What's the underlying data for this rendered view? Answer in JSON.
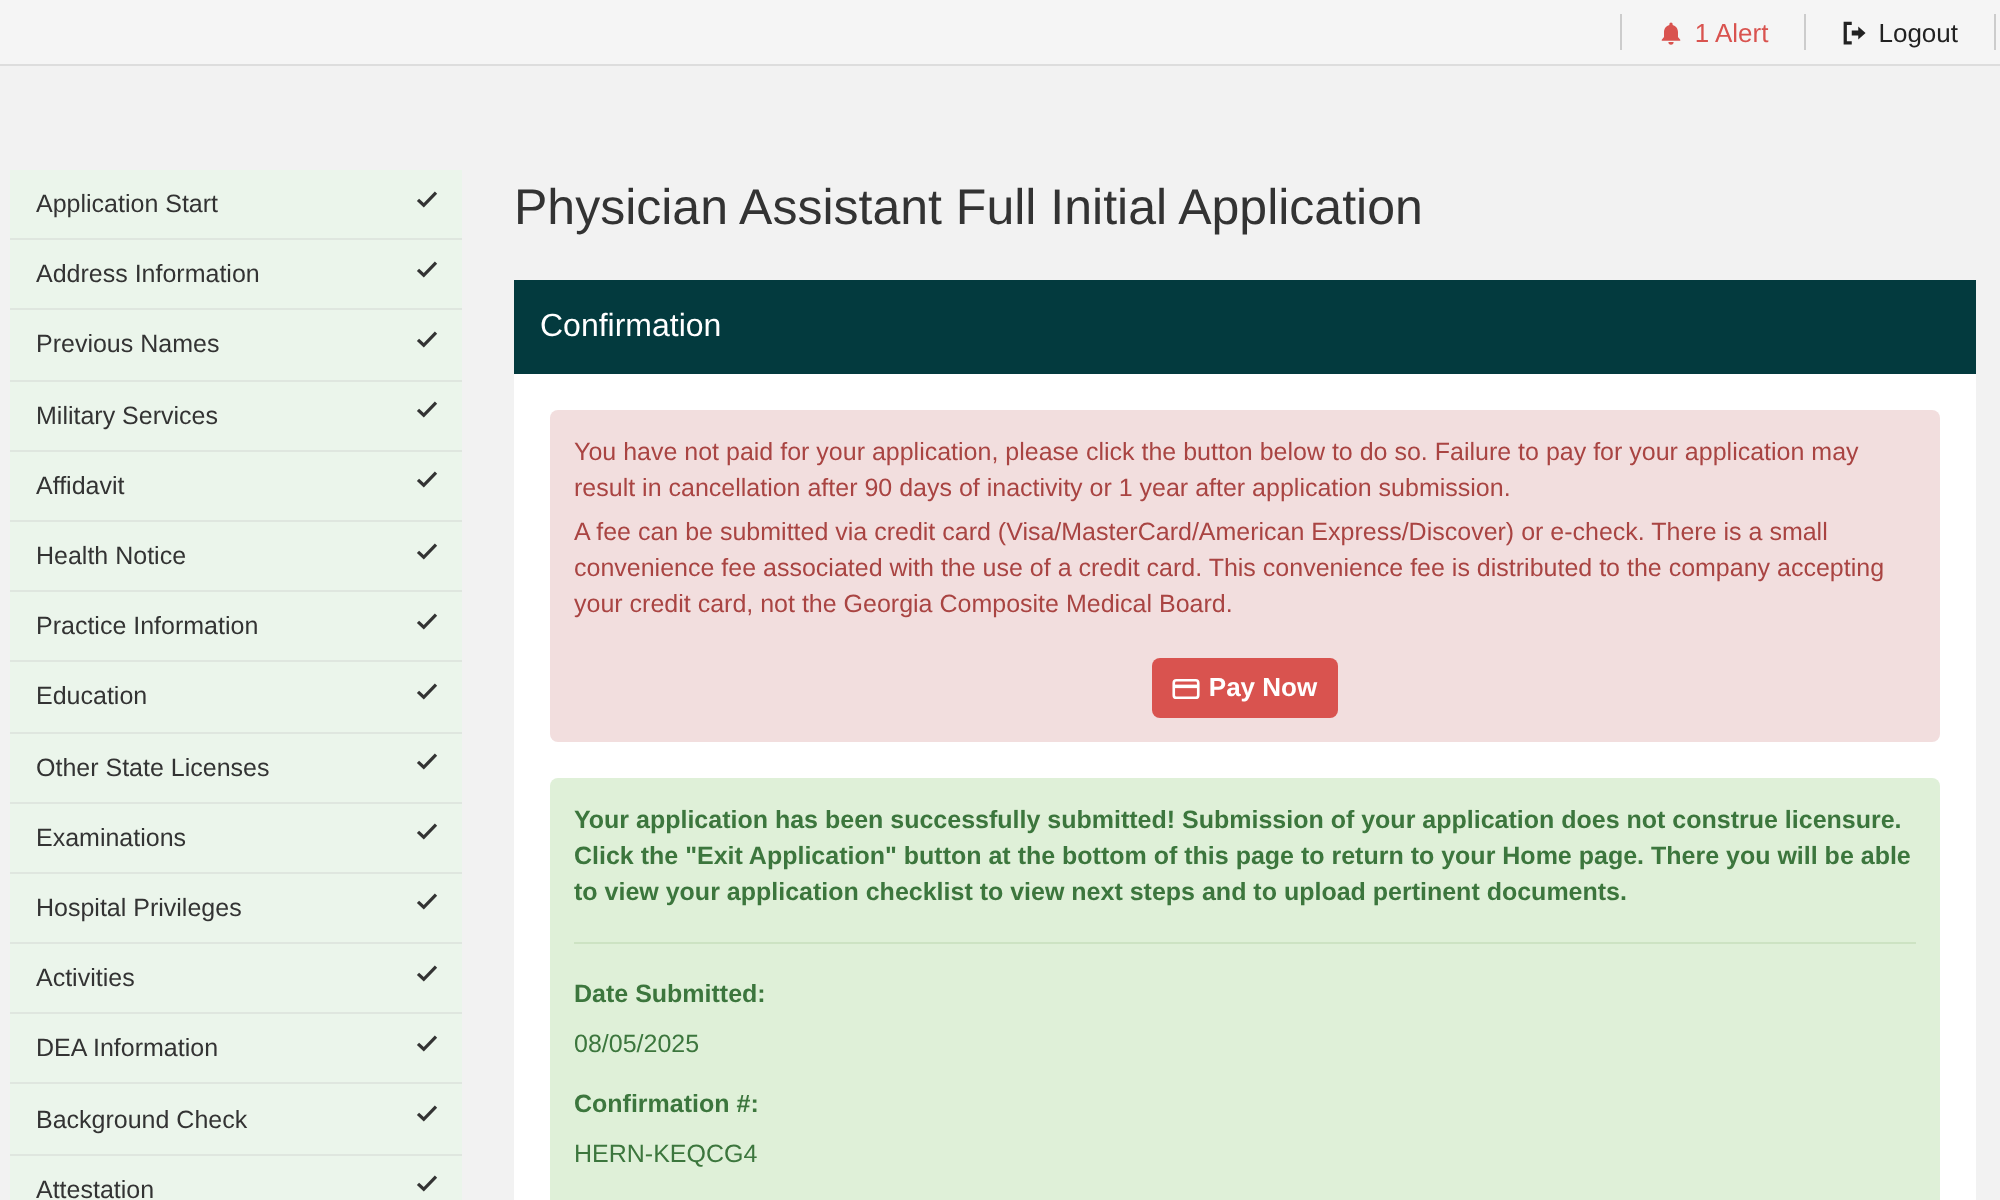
{
  "top_bar": {
    "alert": {
      "count_label": "1 Alert"
    },
    "logout": {
      "label": "Logout"
    }
  },
  "sidebar": {
    "items": [
      {
        "label": "Application Start",
        "completed": true
      },
      {
        "label": "Address Information",
        "completed": true
      },
      {
        "label": "Previous Names",
        "completed": true
      },
      {
        "label": "Military Services",
        "completed": true
      },
      {
        "label": "Affidavit",
        "completed": true
      },
      {
        "label": "Health Notice",
        "completed": true
      },
      {
        "label": "Practice Information",
        "completed": true
      },
      {
        "label": "Education",
        "completed": true
      },
      {
        "label": "Other State Licenses",
        "completed": true
      },
      {
        "label": "Examinations",
        "completed": true
      },
      {
        "label": "Hospital Privileges",
        "completed": true
      },
      {
        "label": "Activities",
        "completed": true
      },
      {
        "label": "DEA Information",
        "completed": true
      },
      {
        "label": "Background Check",
        "completed": true
      },
      {
        "label": "Attestation",
        "completed": true
      }
    ]
  },
  "page": {
    "title": "Physician Assistant Full Initial Application"
  },
  "panel": {
    "heading": "Confirmation",
    "payment_alert": {
      "paragraphs": [
        "You have not paid for your application, please click the button below to do so. Failure to pay for your application may result in cancellation after 90 days of inactivity or 1 year after application submission.",
        "A fee can be submitted via credit card (Visa/MasterCard/American Express/Discover) or e-check. There is a small convenience fee associated with the use of a credit card. This convenience fee is distributed to the company accepting your credit card, not the Georgia Composite Medical Board."
      ],
      "button": "Pay Now"
    },
    "success_alert": {
      "message": "Your application has been successfully submitted! Submission of your application does not construe licensure. Click the \"Exit Application\" button at the bottom of this page to return to your Home page. There you will be able to view your application checklist to view next steps and to upload pertinent documents.",
      "fields": [
        {
          "label": "Date Submitted:",
          "value": "08/05/2025"
        },
        {
          "label": "Confirmation #:",
          "value": "HERN-KEQCG4"
        }
      ]
    }
  }
}
